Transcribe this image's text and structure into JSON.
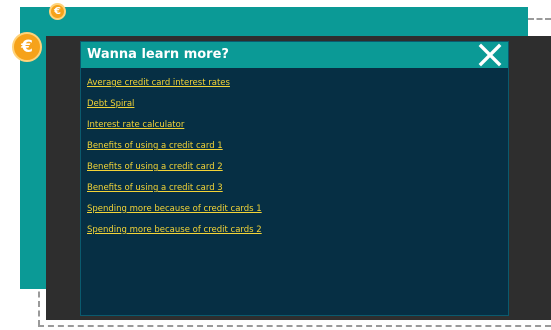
{
  "modal": {
    "title": "Wanna learn more?",
    "close_icon": "close-x-icon",
    "links": [
      {
        "label": "Average credit card interest rates"
      },
      {
        "label": "Debt Spiral"
      },
      {
        "label": "Interest rate calculator"
      },
      {
        "label": "Benefits of using a credit card 1"
      },
      {
        "label": "Benefits of using a credit card 2"
      },
      {
        "label": "Benefits of using a credit card 3"
      },
      {
        "label": "Spending more because of credit cards 1"
      },
      {
        "label": "Spending more because of credit cards 2"
      }
    ]
  },
  "coins": {
    "symbol": "€",
    "icon": "coin-icon"
  },
  "colors": {
    "teal": "#0b9a96",
    "panel": "#062f44",
    "frame": "#2e2e2e",
    "link": "#f3d437",
    "coin": "#f6a21a"
  }
}
